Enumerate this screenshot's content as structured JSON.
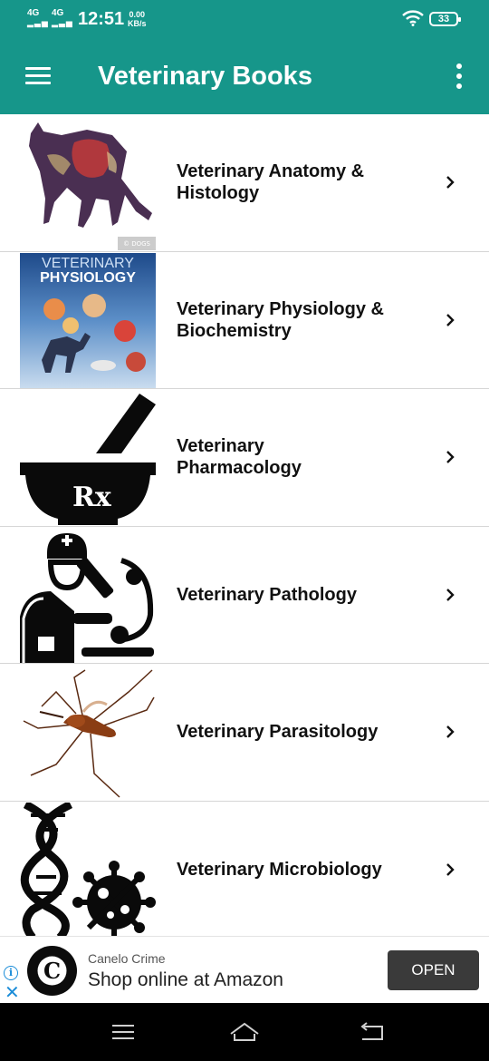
{
  "status_bar": {
    "net1": "4G",
    "net2": "4G",
    "time": "12:51",
    "speed_value": "0.00",
    "speed_unit": "KB/s",
    "battery": "33",
    "wifi_icon": "wifi-icon"
  },
  "app_bar": {
    "title": "Veterinary Books",
    "menu_icon": "menu-icon",
    "more_icon": "more-vert-icon",
    "color": "#16968a"
  },
  "books": [
    {
      "title": "Veterinary Anatomy & Histology",
      "thumb_text": "© DOGS"
    },
    {
      "title": "Veterinary Physiology & Biochemistry",
      "thumb_line1": "VETERINARY",
      "thumb_line2": "PHYSIOLOGY"
    },
    {
      "title": "Veterinary Pharmacology",
      "thumb_text": "Rx"
    },
    {
      "title": "Veterinary Pathology"
    },
    {
      "title": "Veterinary Parasitology"
    },
    {
      "title": "Veterinary Microbiology"
    }
  ],
  "ad": {
    "advertiser": "Canelo Crime",
    "text": "Shop online at Amazon",
    "button": "OPEN",
    "logo_letter": "C"
  }
}
